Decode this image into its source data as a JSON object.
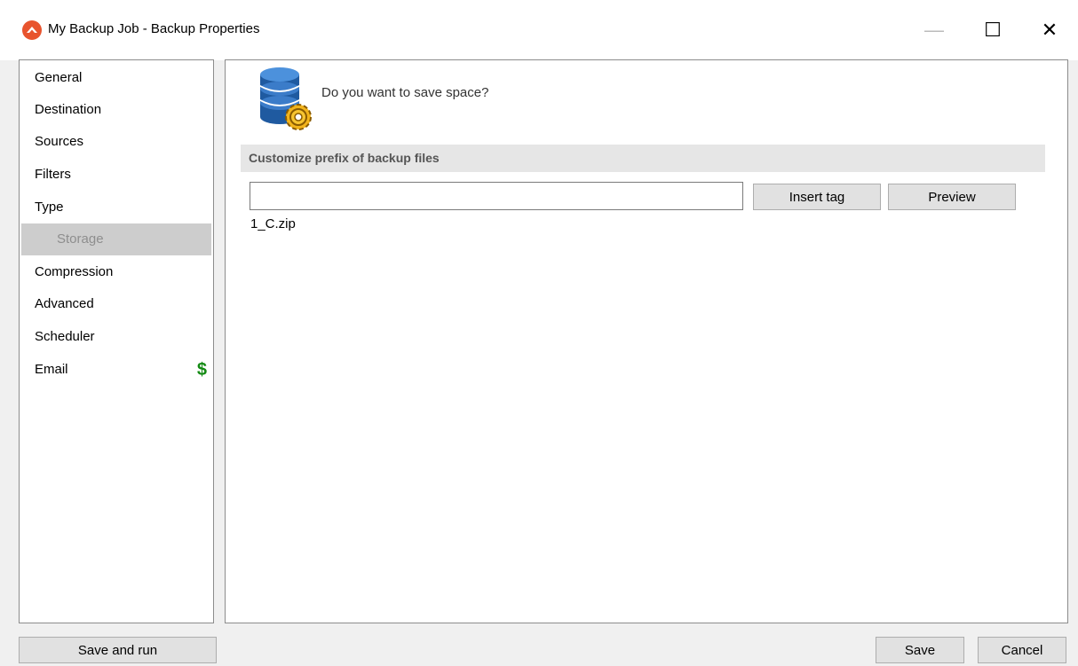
{
  "window": {
    "title": "My Backup Job - Backup Properties",
    "accent": "#e8542e"
  },
  "window_controls": {
    "minimize": "—",
    "maximize": "☐",
    "close": "✕"
  },
  "sidebar": {
    "items": [
      {
        "label": "General"
      },
      {
        "label": "Destination"
      },
      {
        "label": "Sources"
      },
      {
        "label": "Filters"
      },
      {
        "label": "Type"
      },
      {
        "label": "Storage",
        "selected": true
      },
      {
        "label": "Compression"
      },
      {
        "label": "Advanced"
      },
      {
        "label": "Scheduler"
      },
      {
        "label": "Email",
        "badge": "$",
        "badge_icon": "dollar-icon",
        "badge_color": "#138a13"
      }
    ]
  },
  "main": {
    "icon": "database-gear-icon",
    "question": "Do you want to save space?",
    "section_header": "Customize prefix of backup files",
    "prefix_input": {
      "value": "",
      "placeholder": ""
    },
    "insert_tag_label": "Insert tag",
    "preview_label": "Preview",
    "filename_preview": "1_C.zip"
  },
  "footer": {
    "save_and_run_label": "Save and run",
    "save_label": "Save",
    "cancel_label": "Cancel"
  }
}
